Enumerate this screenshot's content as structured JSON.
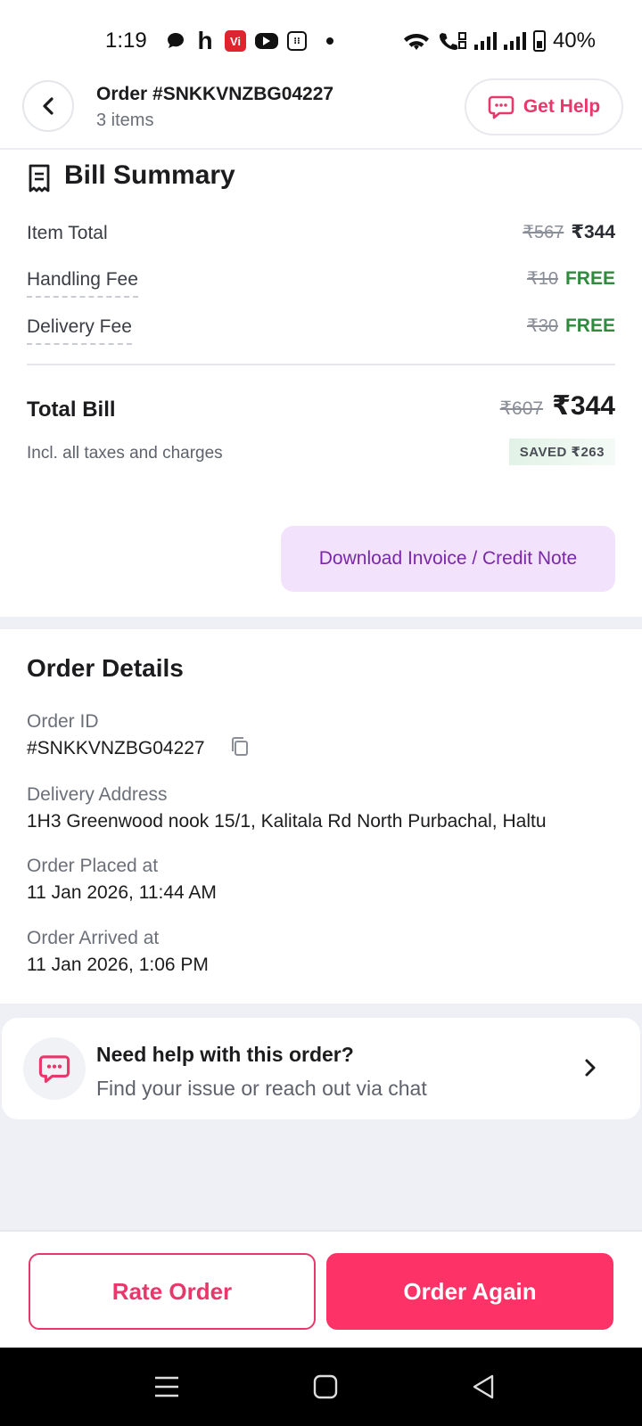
{
  "status_bar": {
    "time": "1:19",
    "battery": "40%",
    "icons": [
      "chat-bubble-icon",
      "h-app-icon",
      "vi-app-icon",
      "youtube-icon",
      "calculator-icon",
      "dot-icon",
      "wifi-icon",
      "volte-call-icon",
      "signal-icon",
      "signal-icon",
      "battery-icon"
    ]
  },
  "header": {
    "title": "Order #SNKKVNZBG04227",
    "subtitle": "3 items",
    "help_label": "Get Help",
    "accent": "#e8386b"
  },
  "bill": {
    "title": "Bill Summary",
    "rows": [
      {
        "label": "Item Total",
        "original": "₹567",
        "value": "₹344"
      },
      {
        "label": "Handling Fee",
        "original": "₹10",
        "value": "FREE"
      },
      {
        "label": "Delivery Fee",
        "original": "₹30",
        "value": "FREE"
      }
    ],
    "total_label": "Total Bill",
    "total_original": "₹607",
    "total_value": "₹344",
    "taxes_note": "Incl. all taxes and charges",
    "saved": "SAVED ₹263",
    "invoice_label": "Download Invoice / Credit Note"
  },
  "order_details": {
    "title": "Order Details",
    "order_id_label": "Order ID",
    "order_id": "#SNKKVNZBG04227",
    "address_label": "Delivery Address",
    "address": "1H3 Greenwood nook  15/1, Kalitala Rd  North Purbachal, Haltu",
    "placed_label": "Order Placed at",
    "placed_at": "11 Jan 2026, 11:44 AM",
    "arrived_label": "Order Arrived at",
    "arrived_at": "11 Jan 2026, 1:06 PM"
  },
  "help_card": {
    "title": "Need help with this order?",
    "subtitle": "Find your issue or reach out via chat"
  },
  "footer": {
    "rate_label": "Rate Order",
    "again_label": "Order Again",
    "primary_color": "#fd3367"
  }
}
